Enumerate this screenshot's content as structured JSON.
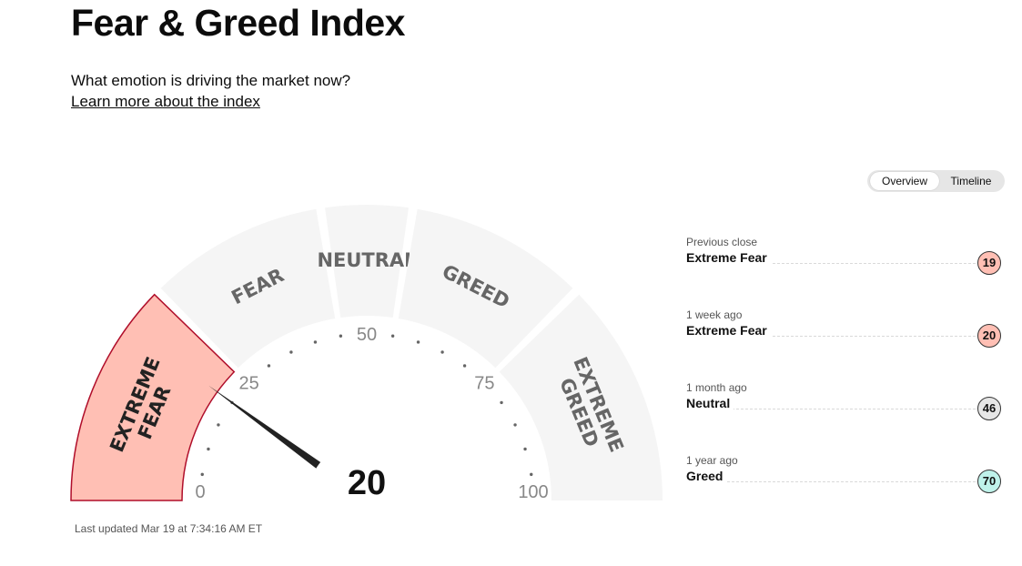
{
  "header": {
    "title": "Fear & Greed Index",
    "subtitle": "What emotion is driving the market now?",
    "learn_more": "Learn more about the index"
  },
  "view_toggle": {
    "options": [
      "Overview",
      "Timeline"
    ],
    "selected": "Overview"
  },
  "gauge": {
    "value": 20,
    "value_label": "20",
    "min": 0,
    "max": 100,
    "tick_labels": [
      "0",
      "25",
      "50",
      "75",
      "100"
    ],
    "segments": [
      {
        "lines": [
          "EXTREME",
          "FEAR"
        ],
        "from": 0,
        "to": 25,
        "active": true
      },
      {
        "lines": [
          "FEAR"
        ],
        "from": 25,
        "to": 45,
        "active": false
      },
      {
        "lines": [
          "NEUTRAL"
        ],
        "from": 45,
        "to": 55,
        "active": false
      },
      {
        "lines": [
          "GREED"
        ],
        "from": 55,
        "to": 75,
        "active": false
      },
      {
        "lines": [
          "EXTREME",
          "GREED"
        ],
        "from": 75,
        "to": 100,
        "active": false
      }
    ],
    "colors": {
      "active_fill": "#ffbfb4",
      "active_stroke": "#b00e2a",
      "inactive_fill": "#f5f5f5",
      "label_color": "#666666"
    }
  },
  "last_updated": "Last updated Mar 19 at 7:34:16 AM ET",
  "history": [
    {
      "label": "Previous close",
      "rating": "Extreme Fear",
      "value": "19",
      "color": "#ffbfb4"
    },
    {
      "label": "1 week ago",
      "rating": "Extreme Fear",
      "value": "20",
      "color": "#ffbfb4"
    },
    {
      "label": "1 month ago",
      "rating": "Neutral",
      "value": "46",
      "color": "#e6e6e6"
    },
    {
      "label": "1 year ago",
      "rating": "Greed",
      "value": "70",
      "color": "#bff2ea"
    }
  ]
}
